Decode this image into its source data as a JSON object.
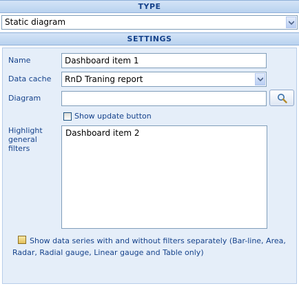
{
  "type_section": {
    "header": "TYPE",
    "selected": "Static diagram"
  },
  "settings_section": {
    "header": "SETTINGS",
    "name_label": "Name",
    "name_value": "Dashboard item 1",
    "data_cache_label": "Data cache",
    "data_cache_value": "RnD Traning report",
    "diagram_label": "Diagram",
    "diagram_value": "",
    "show_update_label": "Show update button",
    "show_update_checked": false,
    "highlight_label_line1": "Highlight",
    "highlight_label_line2": "general",
    "highlight_label_line3": "filters",
    "highlight_items": [
      "Dashboard item 2"
    ],
    "series_label": "Show data series with and without filters separately (Bar-line, Area, Radar, Radial gauge, Linear gauge and Table only)",
    "series_checked": false
  },
  "icons": {
    "search": "magnifier-icon",
    "dropdown": "chevron-down-icon"
  }
}
